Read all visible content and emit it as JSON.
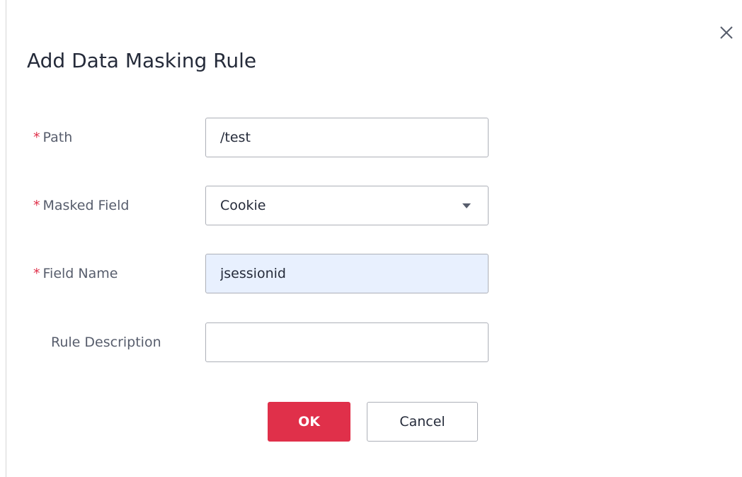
{
  "dialog": {
    "title": "Add Data Masking Rule",
    "close_icon": "close-icon"
  },
  "form": {
    "path": {
      "label": "Path",
      "required": true,
      "value": "/test"
    },
    "masked_field": {
      "label": "Masked Field",
      "required": true,
      "value": "Cookie",
      "icon": "chevron-down-icon"
    },
    "field_name": {
      "label": "Field Name",
      "required": true,
      "value": "jsessionid"
    },
    "rule_description": {
      "label": "Rule Description",
      "required": false,
      "value": ""
    },
    "required_marker": "*"
  },
  "actions": {
    "ok_label": "OK",
    "cancel_label": "Cancel"
  },
  "colors": {
    "accent": "#e0304a",
    "text": "#252b3a",
    "label": "#575d6c",
    "border": "#adb0b8",
    "autofill": "#e8f0fe"
  }
}
